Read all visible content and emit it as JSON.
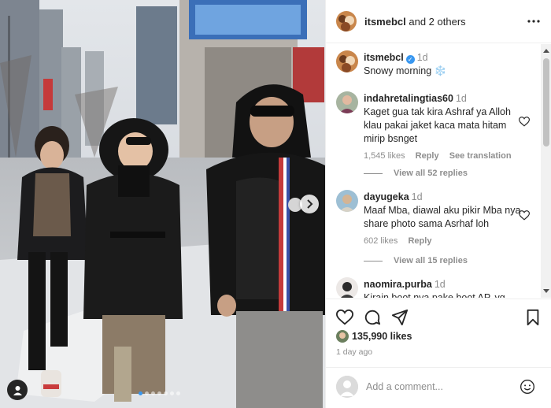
{
  "post": {
    "owner_username": "itsmebcl",
    "owners_suffix": "and 2 others",
    "caption_username": "itsmebcl",
    "caption_time": "1d",
    "caption_text": "Snowy morning ❄️",
    "likes": "135,990 likes",
    "posted_ago": "1 day ago",
    "carousel_slides": 7,
    "carousel_active": 0
  },
  "comments": [
    {
      "username": "indahretalingtias60",
      "time": "1d",
      "text": "Kaget gua tak kira Ashraf ya Alloh klau pakai jaket kaca mata hitam mirip bsnget",
      "likes": "1,545 likes",
      "reply": "Reply",
      "translate": "See translation",
      "view_replies": "View all 52 replies"
    },
    {
      "username": "dayugeka",
      "time": "1d",
      "text": "Maaf Mba, diawal aku pikir Mba nya share photo sama Asrhaf loh",
      "likes": "602 likes",
      "reply": "Reply",
      "view_replies": "View all 15 replies"
    },
    {
      "username": "naomira.purba",
      "time": "1d",
      "text": "Kirain boot nya pake boot AP, yg"
    }
  ],
  "add_comment": {
    "placeholder": "Add a comment..."
  },
  "icons": {
    "more": "more-horizontal-icon",
    "verified": "verified-badge-icon",
    "like": "heart-icon",
    "comment": "comment-icon",
    "share": "share-icon",
    "save": "bookmark-icon",
    "emoji": "emoji-icon",
    "next": "chevron-right-icon",
    "tag": "user-tag-icon"
  },
  "colors": {
    "accent": "#3897f0",
    "text": "#262626",
    "muted": "#8e8e8e"
  }
}
